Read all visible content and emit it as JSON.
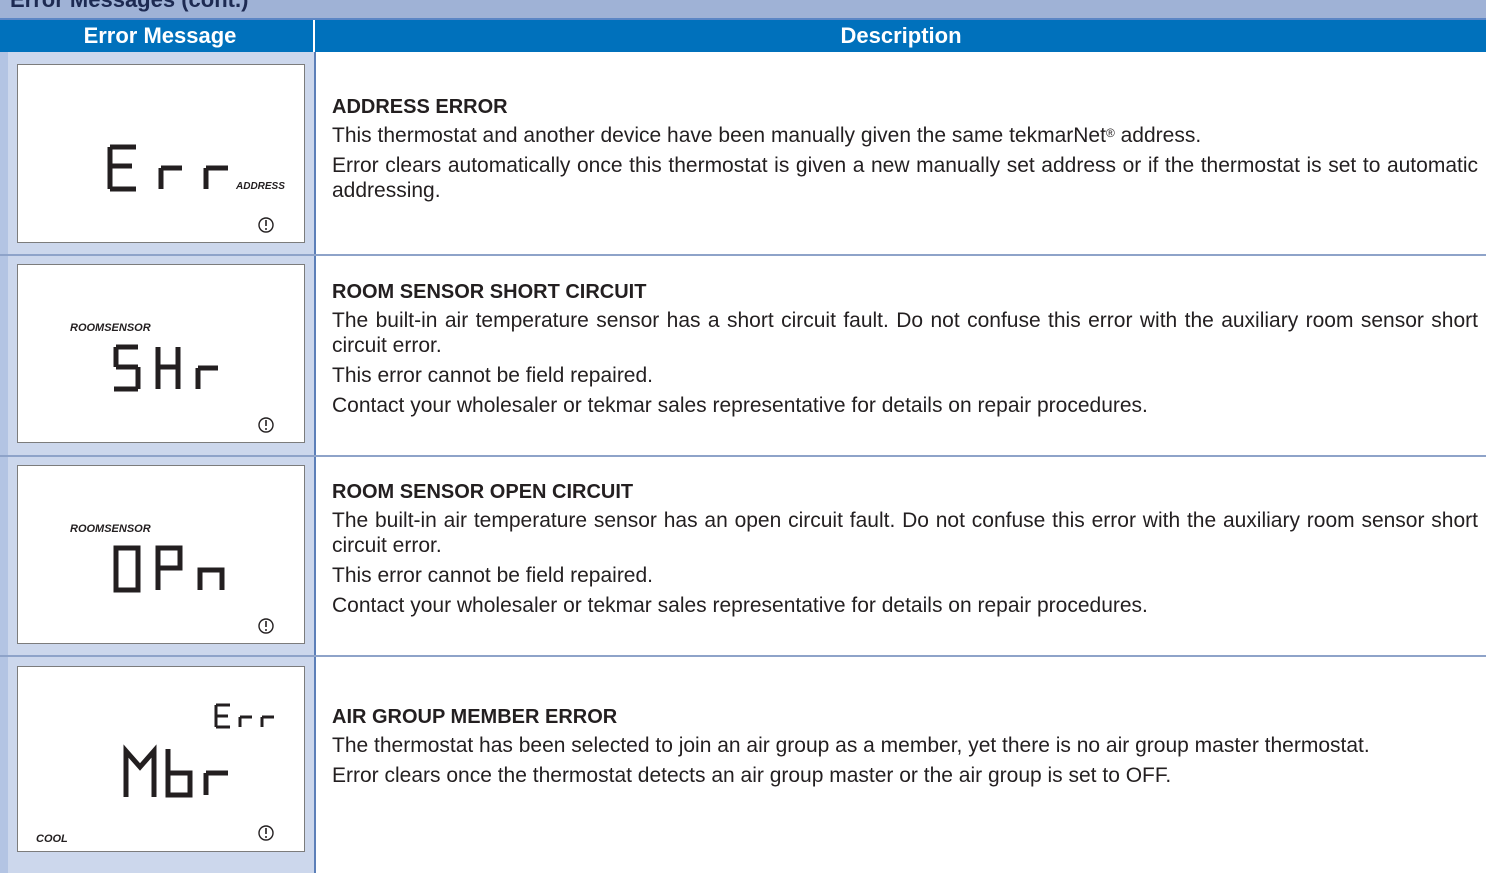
{
  "page": {
    "partial_title": "Error Messages (cont.)"
  },
  "table": {
    "headers": {
      "error_message": "Error Message",
      "description": "Description"
    },
    "rows": [
      {
        "display": {
          "main": "Err",
          "label": "ADDRESS",
          "icon": "warning-icon"
        },
        "title": "ADDRESS ERROR",
        "lines": [
          "This thermostat and another device have been manually given the same tekmarNet® address.",
          "Error clears automatically once this thermostat is given a new manually set address or if the thermostat is set to automatic addressing."
        ]
      },
      {
        "display": {
          "main": "SHr",
          "label": "ROOMSENSOR",
          "icon": "warning-icon"
        },
        "title": "ROOM SENSOR SHORT CIRCUIT",
        "lines": [
          "The built-in air temperature sensor has a short circuit fault. Do not confuse this error with the auxiliary room sensor short circuit error.",
          "This error cannot be field repaired.",
          "Contact your wholesaler or tekmar sales representative for details on repair procedures."
        ]
      },
      {
        "display": {
          "main": "OPn",
          "label": "ROOMSENSOR",
          "icon": "warning-icon"
        },
        "title": "ROOM SENSOR OPEN CIRCUIT",
        "lines": [
          "The built-in air temperature sensor has an open circuit fault. Do not confuse this error with the auxiliary room sensor short circuit error.",
          "This error cannot be field repaired.",
          "Contact your wholesaler or tekmar sales representative for details on repair procedures."
        ]
      },
      {
        "display": {
          "top": "Err",
          "main": "Mbr",
          "label": "COOL",
          "icon": "warning-icon"
        },
        "title": "AIR GROUP MEMBER ERROR",
        "lines": [
          "The thermostat has been selected to join an air group as a member, yet there is no air group master thermostat.",
          "Error clears once the thermostat detects an air group master or the air group is set to OFF."
        ]
      }
    ]
  },
  "colors": {
    "header_bg": "#0071bc",
    "left_col_bg": "#ccd7ec",
    "strip_bg": "#9fb2d6"
  }
}
